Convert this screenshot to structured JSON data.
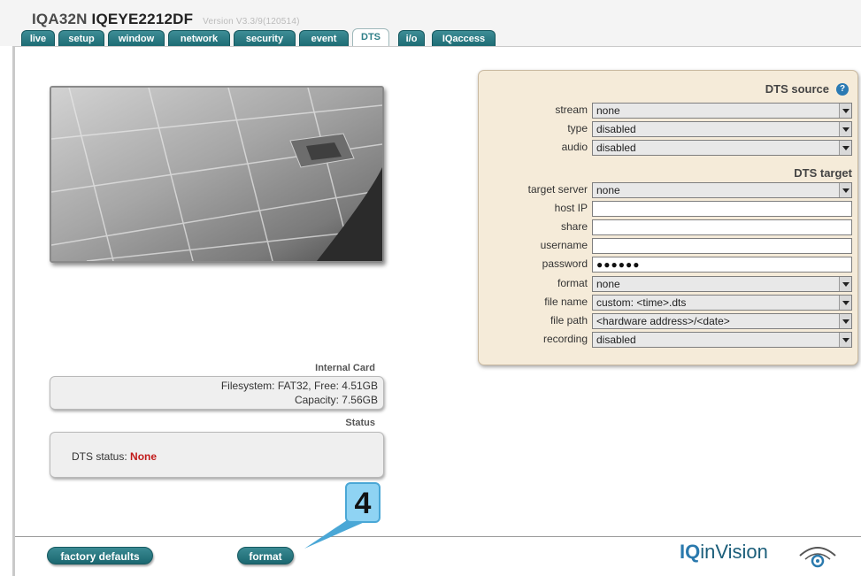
{
  "header": {
    "title_prefix": "IQA32N",
    "title_model": "IQEYE2212DF",
    "version": "Version V3.3/9(120514)"
  },
  "tabs": [
    {
      "label": "live"
    },
    {
      "label": "setup"
    },
    {
      "label": "window"
    },
    {
      "label": "network"
    },
    {
      "label": "security"
    },
    {
      "label": "event"
    },
    {
      "label": "DTS"
    },
    {
      "label": "i/o"
    },
    {
      "label": "IQaccess"
    }
  ],
  "internal_card": {
    "heading": "Internal Card",
    "filesystem": "Filesystem: FAT32, Free: 4.51GB",
    "capacity": "Capacity: 7.56GB"
  },
  "status": {
    "heading": "Status",
    "label": "DTS status: ",
    "value": "None"
  },
  "dts_source": {
    "heading": "DTS source",
    "help_icon": "?",
    "stream_label": "stream",
    "stream_value": "none",
    "type_label": "type",
    "type_value": "disabled",
    "audio_label": "audio",
    "audio_value": "disabled"
  },
  "dts_target": {
    "heading": "DTS target",
    "target_server_label": "target server",
    "target_server_value": "none",
    "host_ip_label": "host IP",
    "host_ip_value": "",
    "share_label": "share",
    "share_value": "",
    "username_label": "username",
    "username_value": "",
    "password_label": "password",
    "password_value": "●●●●●●",
    "format_label": "format",
    "format_value": "none",
    "file_name_label": "file name",
    "file_name_value": "custom: <time>.dts",
    "file_path_label": "file path",
    "file_path_value": "<hardware address>/<date>",
    "recording_label": "recording",
    "recording_value": "disabled"
  },
  "footer": {
    "factory_defaults": "factory defaults",
    "format": "format",
    "logo_iq": "IQ",
    "logo_rest": "inVision"
  },
  "callout": {
    "number": "4"
  },
  "colors": {
    "accent": "#1d6c74",
    "status_error": "#c21b1b",
    "panel": "#f5ebd9",
    "logo": "#2a79ad"
  }
}
